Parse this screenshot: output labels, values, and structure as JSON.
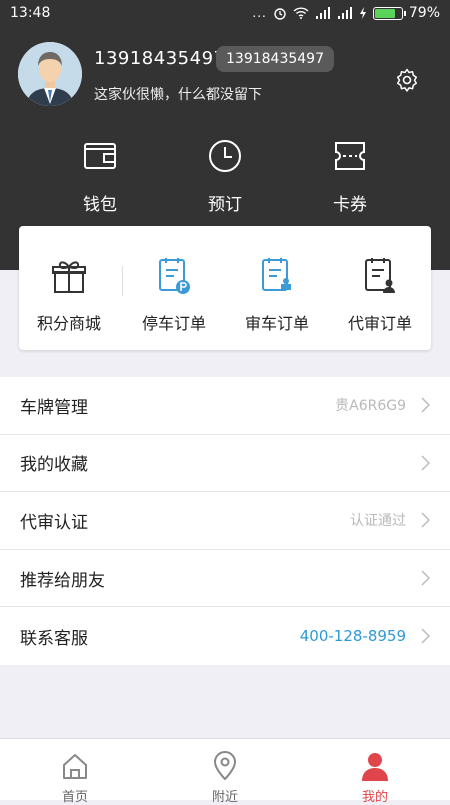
{
  "status_bar": {
    "time": "13:48",
    "dots": "...",
    "battery": "79%",
    "battery_level": 0.79
  },
  "profile": {
    "username": "13918435497",
    "phone_badge": "13918435497",
    "signature": "这家伙很懒，什么都没留下",
    "icons": {
      "avatar": "avatar",
      "settings": "gear-icon"
    }
  },
  "quick_actions": [
    {
      "label": "钱包",
      "icon": "wallet-icon"
    },
    {
      "label": "预订",
      "icon": "clock-icon"
    },
    {
      "label": "卡券",
      "icon": "ticket-icon"
    }
  ],
  "card": {
    "items": [
      {
        "label": "积分商城",
        "icon": "gift-icon"
      },
      {
        "label": "停车订单",
        "icon": "parking-order-icon"
      },
      {
        "label": "审车订单",
        "icon": "inspection-order-icon"
      },
      {
        "label": "代审订单",
        "icon": "agent-order-icon"
      }
    ]
  },
  "menu": [
    {
      "title": "车牌管理",
      "value": "贵A6R6G9"
    },
    {
      "title": "我的收藏",
      "value": ""
    },
    {
      "title": "代审认证",
      "value": "认证通过"
    },
    {
      "title": "推荐给朋友",
      "value": ""
    },
    {
      "title": "联系客服",
      "value": "400-128-8959"
    }
  ],
  "tabs": [
    {
      "label": "首页",
      "icon": "home-icon"
    },
    {
      "label": "附近",
      "icon": "location-pin-icon"
    },
    {
      "label": "我的",
      "icon": "profile-icon"
    }
  ],
  "colors": {
    "header_bg": "#333333",
    "accent_red": "#e0454b",
    "link_blue": "#2d9ad8",
    "icon_blue": "#3d9ad8"
  }
}
